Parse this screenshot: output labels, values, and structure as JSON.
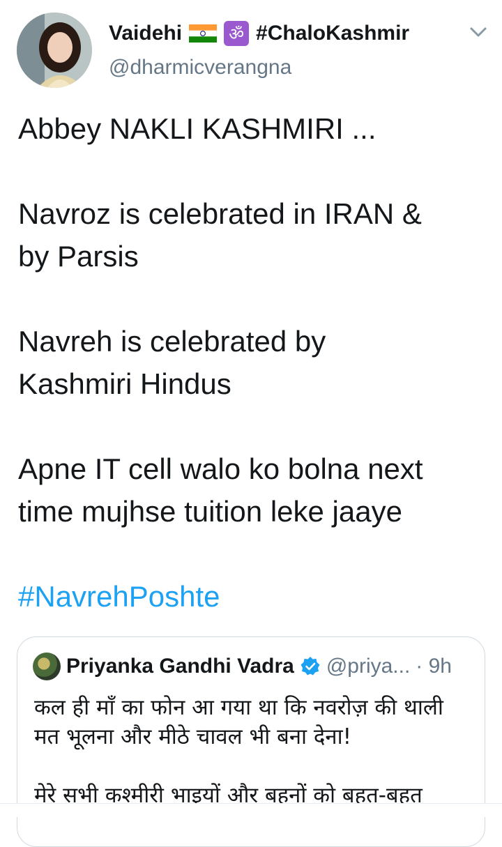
{
  "tweet": {
    "author": {
      "name": "Vaidehi",
      "hashtag": "#ChaloKashmir",
      "handle": "@dharmicverangna",
      "icons": [
        "india-flag-icon",
        "om-icon",
        "chevron-down-icon"
      ]
    },
    "lines": [
      "Abbey NAKLI KASHMIRI ...",
      "Navroz is celebrated in IRAN &",
      "by Parsis",
      "Navreh is celebrated by",
      "Kashmiri Hindus",
      "Apne IT cell walo ko bolna next",
      "time mujhse tuition leke jaaye"
    ],
    "hashtag": "#NavrehPoshte"
  },
  "quoted_tweet": {
    "name": "Priyanka Gandhi Vadra",
    "handle": "@priya...",
    "time": "· 9h",
    "lines": [
      "कल ही माँ का फोन आ गया था कि नवरोज़ की थाली",
      "मत भूलना और मीठे चावल भी बना देना!",
      "मेरे सभी कश्मीरी भाइयों और बहनों को बहुत-बहुत"
    ]
  },
  "colors": {
    "text": "#14171a",
    "secondary": "#657786",
    "link": "#1da1f2",
    "border": "#cfd9de"
  }
}
